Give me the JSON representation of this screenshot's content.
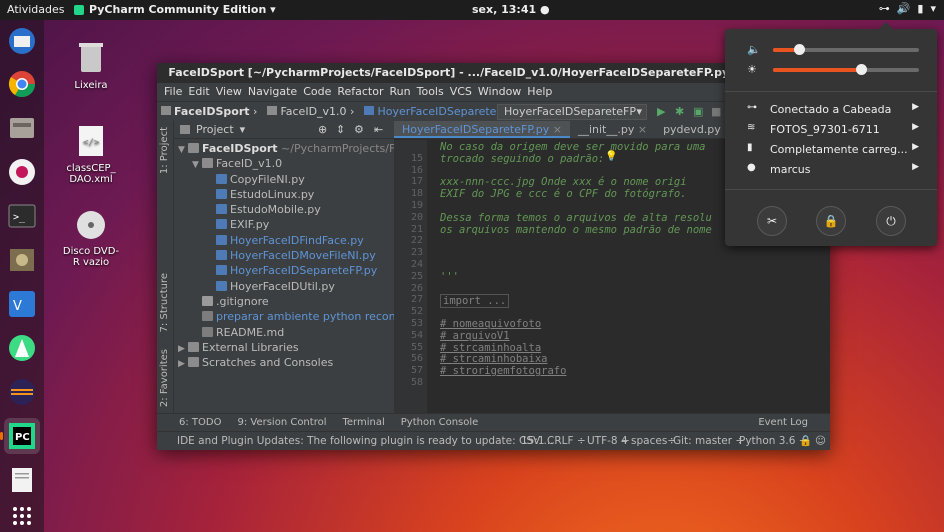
{
  "topbar": {
    "activities": "Atividades",
    "app_menu": "PyCharm Community Edition ▾",
    "clock": "sex, 13:41 ●"
  },
  "desktop": {
    "icons": [
      {
        "label": "Lixeira"
      },
      {
        "label": "classCEP_\nDAO.xml"
      },
      {
        "label": "Disco DVD-\nR vazio"
      }
    ]
  },
  "ide": {
    "title": "FaceIDSport [~/PycharmProjects/FaceIDSport] - .../FaceID_v1.0/HoyerFaceIDSepareteFP.py [FaceIDSport]",
    "menu": [
      "File",
      "Edit",
      "View",
      "Navigate",
      "Code",
      "Refactor",
      "Run",
      "Tools",
      "VCS",
      "Window",
      "Help"
    ],
    "breadcrumbs": [
      "FaceIDSport",
      "FaceID_v1.0",
      "HoyerFaceIDSepareteFP.py"
    ],
    "run_config": "HoyerFaceIDSepareteFP",
    "project_header": "Project",
    "side_tabs": {
      "project": "1: Project",
      "structure": "7: Structure",
      "favorites": "2: Favorites"
    },
    "tree": {
      "root": "FaceIDSport",
      "root_path": "~/PycharmProjects/FaceID",
      "folder": "FaceID_v1.0",
      "files": [
        {
          "name": "CopyFileNI.py",
          "vcs": "normal"
        },
        {
          "name": "EstudoLinux.py",
          "vcs": "normal"
        },
        {
          "name": "EstudoMobile.py",
          "vcs": "normal"
        },
        {
          "name": "EXIF.py",
          "vcs": "normal"
        },
        {
          "name": "HoyerFaceIDFindFace.py",
          "vcs": "modified"
        },
        {
          "name": "HoyerFaceIDMoveFileNI.py",
          "vcs": "modified"
        },
        {
          "name": "HoyerFaceIDSepareteFP.py",
          "vcs": "modified"
        },
        {
          "name": "HoyerFaceIDUtil.py",
          "vcs": "normal"
        }
      ],
      "gitignore": ".gitignore",
      "prep": "preparar ambiente python reconhecim",
      "readme": "README.md",
      "external": "External Libraries",
      "scratches": "Scratches and Consoles"
    },
    "tabs": [
      "HoyerFaceIDSepareteFP.py",
      "__init__.py",
      "pydevd.py"
    ],
    "lines": [
      {
        "n": "",
        "text": "No caso da origem deve ser movido para uma",
        "style": "cm"
      },
      {
        "n": "15",
        "text": "trocado seguindo o padrão:",
        "style": "cm"
      },
      {
        "n": "16",
        "text": "",
        "style": "cm"
      },
      {
        "n": "17",
        "text": "    xxx-nnn-ccc.jpg Onde xxx é o nome origi",
        "style": "cm"
      },
      {
        "n": "18",
        "text": "    EXIF do JPG e ccc é o CPF do fotógrafo.",
        "style": "cm"
      },
      {
        "n": "19",
        "text": "",
        "style": "cm"
      },
      {
        "n": "20",
        "text": "Dessa forma temos o arquivos de alta resolu",
        "style": "cm"
      },
      {
        "n": "21",
        "text": "os arquivos mantendo o mesmo padrão de nome",
        "style": "cm"
      },
      {
        "n": "22",
        "text": "",
        "style": "cm"
      },
      {
        "n": "23",
        "text": "",
        "style": "cm"
      },
      {
        "n": "24",
        "text": "",
        "style": "cm"
      },
      {
        "n": "25",
        "text": "'''",
        "style": "cm"
      },
      {
        "n": "26",
        "text": "",
        "style": "gr"
      },
      {
        "n": "27",
        "text": "import ...",
        "style": "gr"
      },
      {
        "n": "52",
        "text": "",
        "style": "gr"
      },
      {
        "n": "53",
        "text": "# nomeaquivofoto",
        "style": "gr"
      },
      {
        "n": "54",
        "text": "# arquivoV1",
        "style": "gr"
      },
      {
        "n": "55",
        "text": "# strcaminhoalta",
        "style": "gr"
      },
      {
        "n": "56",
        "text": "# strcaminhobaixa",
        "style": "gr"
      },
      {
        "n": "57",
        "text": "# strorigemfotografo",
        "style": "gr"
      },
      {
        "n": "58",
        "text": "",
        "style": "gr"
      }
    ],
    "tool_windows": [
      "6: TODO",
      "9: Version Control",
      "Terminal",
      "Python Console",
      "Event Log"
    ],
    "status": {
      "message": "IDE and Plugin Updates: The following plugin is ready to update: CSV ...",
      "position": "15:1",
      "line_sep": "CRLF ÷",
      "encoding": "UTF-8 ÷",
      "indent": "4 spaces÷",
      "git": "Git: master ÷",
      "interpreter": "Python 3.6 ÷"
    }
  },
  "system_menu": {
    "volume_level": 0.18,
    "brightness_level": 0.6,
    "items": [
      "Conectado a Cabeada",
      "FOTOS_97301-6711",
      "Completamente carreg...",
      "marcus"
    ]
  }
}
